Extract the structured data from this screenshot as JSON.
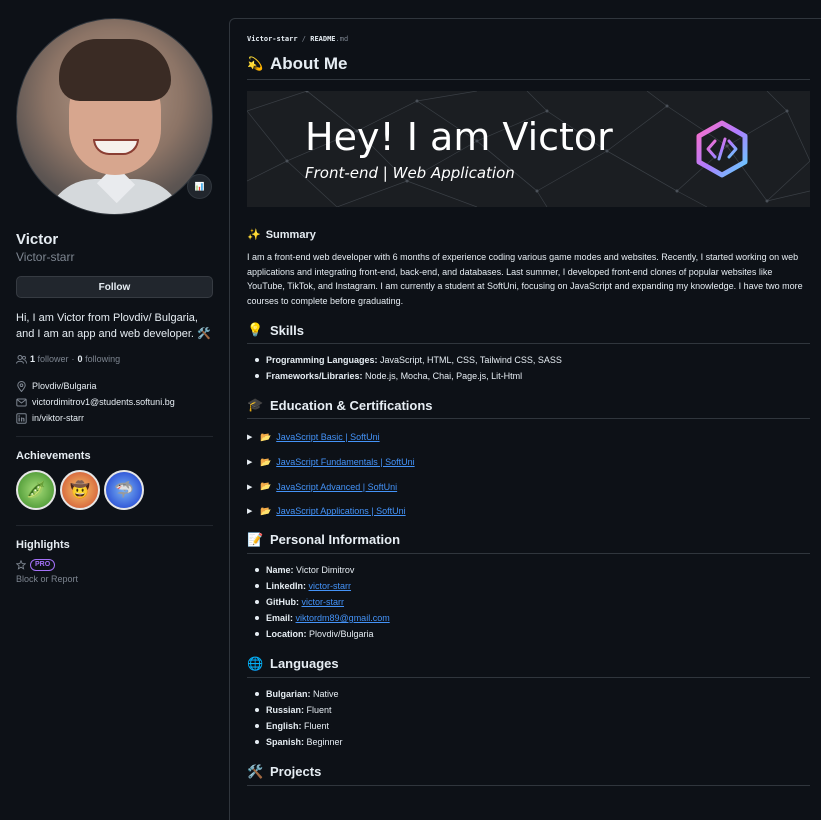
{
  "profile": {
    "name": "Victor",
    "login": "Victor-starr",
    "follow_label": "Follow",
    "bio": "Hi, I am Victor from Plovdiv/ Bulgaria, and I am an app and web developer. 🛠️",
    "followers_count": "1",
    "followers_label": "follower",
    "following_count": "0",
    "following_label": "following",
    "location": "Plovdiv/Bulgaria",
    "email": "victordimitrov1@students.softuni.bg",
    "linkedin": "in/viktor-starr",
    "status_emoji": "📊"
  },
  "achievements": {
    "title": "Achievements",
    "badges": [
      "🫛",
      "🤠",
      "🦈"
    ]
  },
  "highlights": {
    "title": "Highlights",
    "pro": "PRO",
    "block_report": "Block or Report"
  },
  "readme": {
    "breadcrumb_user": "Victor-starr",
    "breadcrumb_sep": "/",
    "breadcrumb_file": "README",
    "breadcrumb_ext": ".md",
    "about_title": "About Me",
    "about_emoji": "💫",
    "banner_title": "Hey! I am Victor",
    "banner_subtitle": "Front-end | Web Application",
    "summary_title": "Summary",
    "summary_emoji": "✨",
    "summary_text": "I am a front-end web developer with 6 months of experience coding various game modes and websites. Recently, I started working on web applications and integrating front-end, back-end, and databases. Last summer, I developed front-end clones of popular websites like YouTube, TikTok, and Instagram. I am currently a student at SoftUni, focusing on JavaScript and expanding my knowledge. I have two more courses to complete before graduating.",
    "skills_title": "Skills",
    "skills_emoji": "💡",
    "skills": [
      {
        "label": "Programming Languages:",
        "value": " JavaScript, HTML, CSS, Tailwind CSS, SASS"
      },
      {
        "label": "Frameworks/Libraries:",
        "value": " Node.js, Mocha, Chai, Page.js, Lit-Html"
      }
    ],
    "education_title": "Education & Certifications",
    "education_emoji": "🎓",
    "education": [
      "JavaScript Basic | SoftUni",
      "JavaScript Fundamentals | SoftUni",
      "JavaScript Advanced | SoftUni",
      "JavaScript Applications | SoftUni"
    ],
    "personal_title": "Personal Information",
    "personal_emoji": "📝",
    "personal": [
      {
        "label": "Name:",
        "value": " Victor Dimitrov",
        "link": ""
      },
      {
        "label": "LinkedIn:",
        "value": "",
        "link": "victor-starr"
      },
      {
        "label": "GitHub:",
        "value": "",
        "link": "victor-starr"
      },
      {
        "label": "Email:",
        "value": "",
        "link": "viktordm89@gmail.com"
      },
      {
        "label": "Location:",
        "value": " Plovdiv/Bulgaria",
        "link": ""
      }
    ],
    "languages_title": "Languages",
    "languages_emoji": "🌐",
    "languages": [
      {
        "label": "Bulgarian:",
        "value": " Native"
      },
      {
        "label": "Russian:",
        "value": " Fluent"
      },
      {
        "label": "English:",
        "value": " Fluent"
      },
      {
        "label": "Spanish:",
        "value": " Beginner"
      }
    ],
    "projects_title": "Projects",
    "projects_emoji": "🛠️"
  },
  "icons": {
    "people": "people-icon",
    "location": "location-icon",
    "mail": "mail-icon",
    "linkedin": "linkedin-icon",
    "star": "star-icon",
    "folder": "folder-icon",
    "triangle": "disclosure-triangle-icon"
  },
  "colors": {
    "background": "#0d1117",
    "text": "#e6edf3",
    "muted": "#7d8590",
    "link": "#4493f8",
    "border": "#30363d",
    "pro": "#a371f7"
  }
}
